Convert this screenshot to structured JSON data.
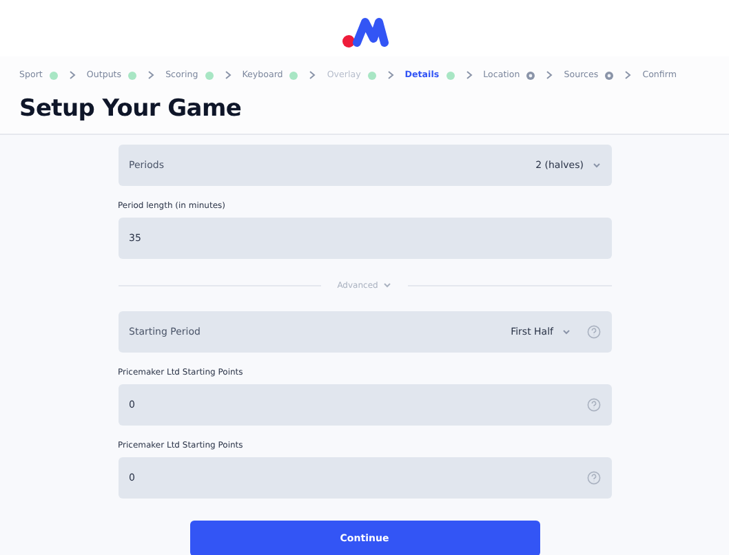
{
  "steps": [
    {
      "label": "Sport",
      "completed": true,
      "selected": false,
      "disabled": false
    },
    {
      "label": "Outputs",
      "completed": true,
      "selected": false,
      "disabled": false
    },
    {
      "label": "Scoring",
      "completed": true,
      "selected": false,
      "disabled": false
    },
    {
      "label": "Keyboard",
      "completed": true,
      "selected": false,
      "disabled": false
    },
    {
      "label": "Overlay",
      "completed": true,
      "selected": false,
      "disabled": true
    },
    {
      "label": "Details",
      "completed": true,
      "selected": true,
      "disabled": false
    },
    {
      "label": "Location",
      "completed": false,
      "selected": false,
      "disabled": false
    },
    {
      "label": "Sources",
      "completed": false,
      "selected": false,
      "disabled": false
    },
    {
      "label": "Confirm",
      "selected": false,
      "disabled": false
    }
  ],
  "title": "Setup Your Game",
  "fields": [
    {
      "kind": "select",
      "label": "Periods",
      "value": "2 (halves)",
      "help": false
    },
    {
      "kind": "input",
      "label": "Period length (in minutes)",
      "value": "35",
      "help": false
    },
    {
      "kind": "divider",
      "label": "Advanced"
    },
    {
      "kind": "select",
      "label": "Starting Period",
      "value": "First Half",
      "help": true
    },
    {
      "kind": "input",
      "label": "Pricemaker Ltd Starting Points",
      "value": "0",
      "help": true
    },
    {
      "kind": "input",
      "label": "Pricemaker Ltd Starting Points",
      "value": "0",
      "help": true
    }
  ],
  "button": "Continue"
}
